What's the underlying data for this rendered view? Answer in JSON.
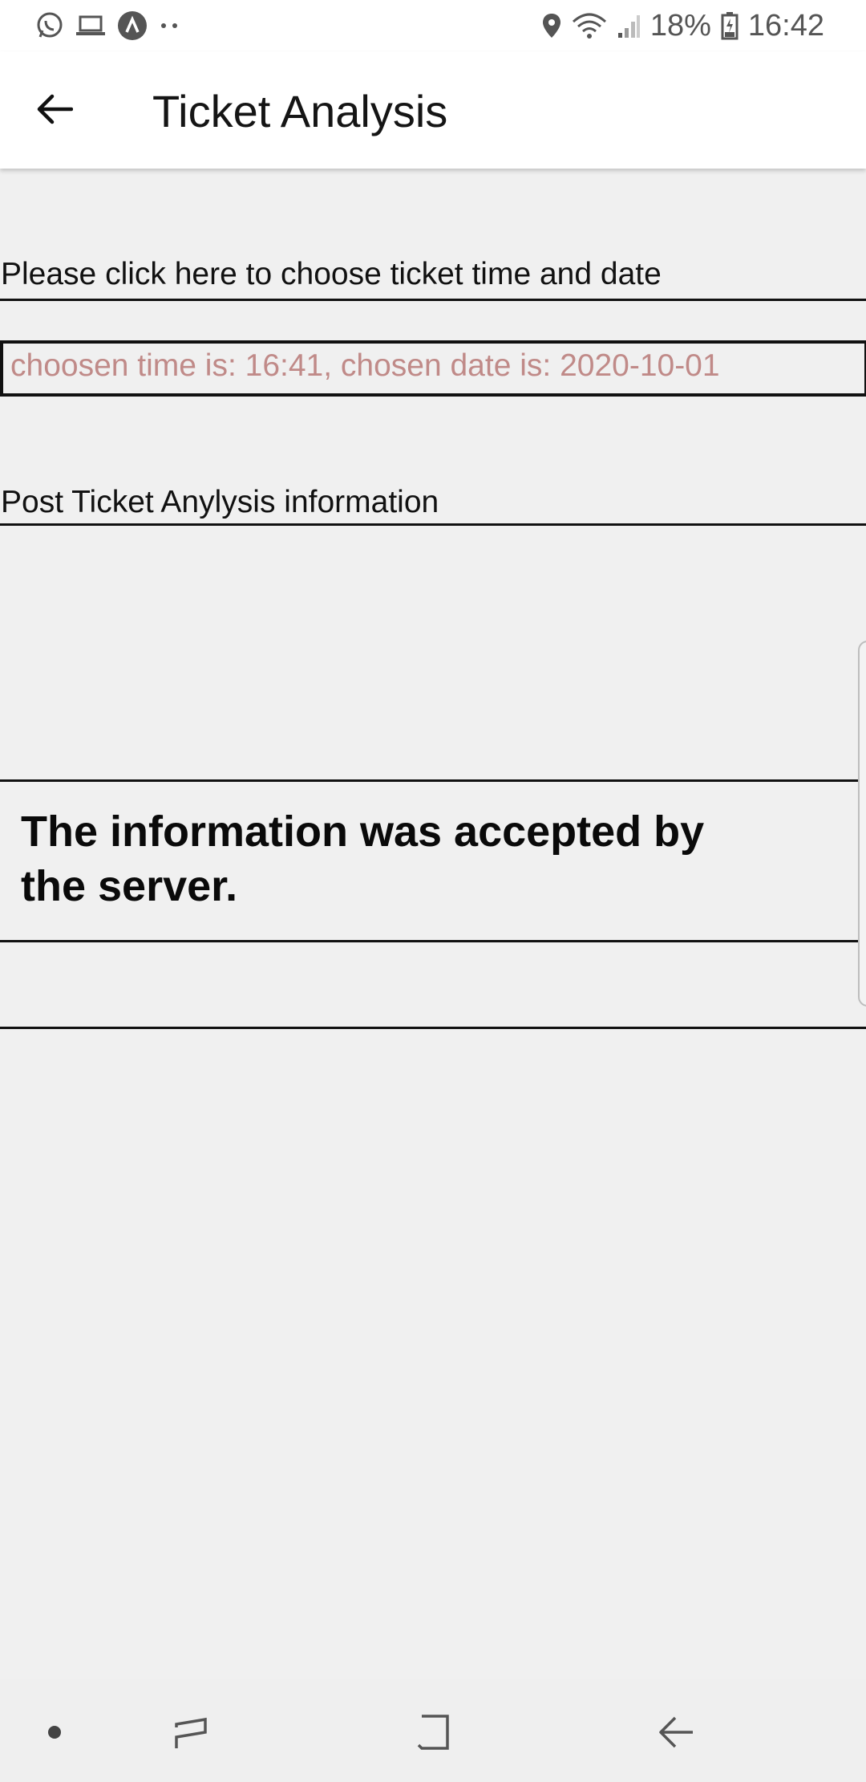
{
  "status_bar": {
    "battery": "18%",
    "time": "16:42",
    "left_icons": [
      "whatsapp-icon",
      "laptop-icon",
      "app-a-icon",
      "more-dots-icon"
    ],
    "right_icons": [
      "location-icon",
      "wifi-icon",
      "signal-icon",
      "battery-icon"
    ]
  },
  "app_bar": {
    "title": "Ticket Analysis",
    "back_icon": "arrow-left-icon"
  },
  "content": {
    "choose_link": "Please click here to choose ticket time and date",
    "chosen_text": "choosen time is: 16:41, chosen date is: 2020-10-01",
    "post_button": "Post Ticket Anylysis information",
    "response_text": "The information was accepted by the server."
  },
  "nav_bar": {
    "items": [
      "dot-icon",
      "recents-icon",
      "home-icon",
      "back-icon"
    ]
  },
  "colors": {
    "background": "#f0f0f0",
    "chosen_text": "#c08a88",
    "bar": "#ffffff"
  }
}
